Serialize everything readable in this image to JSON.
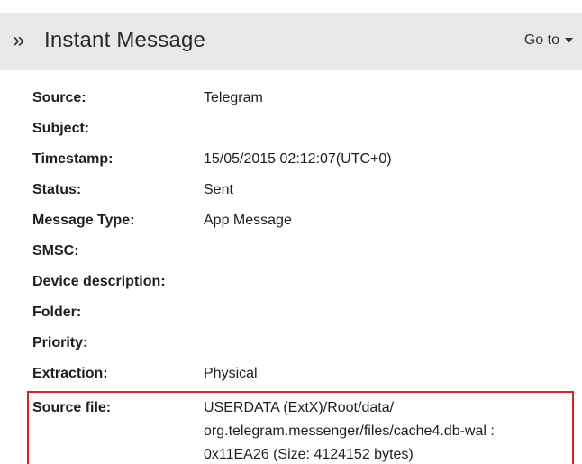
{
  "header": {
    "title": "Instant Message",
    "chevrons": "»",
    "goto_label": "Go to"
  },
  "fields": [
    {
      "label": "Source:",
      "value": "Telegram"
    },
    {
      "label": "Subject:",
      "value": ""
    },
    {
      "label": "Timestamp:",
      "value": "15/05/2015 02:12:07(UTC+0)"
    },
    {
      "label": "Status:",
      "value": "Sent"
    },
    {
      "label": "Message Type:",
      "value": "App Message"
    },
    {
      "label": "SMSC:",
      "value": ""
    },
    {
      "label": "Device description:",
      "value": ""
    },
    {
      "label": "Folder:",
      "value": ""
    },
    {
      "label": "Priority:",
      "value": ""
    },
    {
      "label": "Extraction:",
      "value": "Physical"
    }
  ],
  "source_file": {
    "label": "Source file:",
    "lines": [
      "USERDATA (ExtX)/Root/data/",
      "org.telegram.messenger/files/cache4.db-wal :",
      "0x11EA26 (Size: 4124152 bytes)"
    ]
  },
  "colors": {
    "header_bg": "#e8e8e8",
    "highlight_border": "#e02020"
  }
}
